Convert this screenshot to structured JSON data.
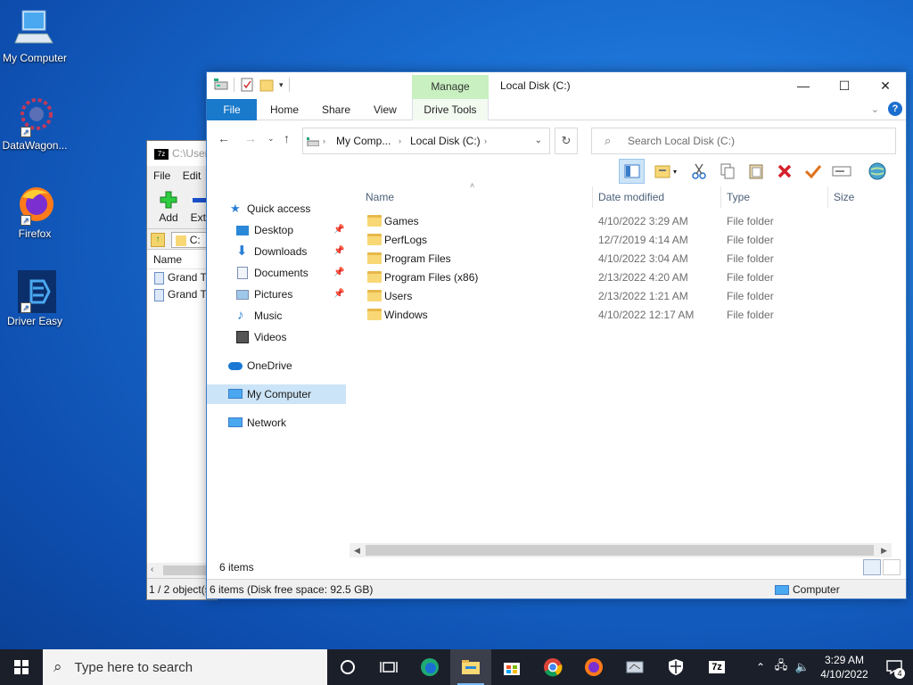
{
  "desktop": {
    "icons": [
      {
        "label": "My Computer"
      },
      {
        "label": "DataWagon..."
      },
      {
        "label": "Firefox"
      },
      {
        "label": "Driver Easy"
      }
    ]
  },
  "zip_window": {
    "title": "C:\\User",
    "logo": "7z",
    "menu": [
      "File",
      "Edit"
    ],
    "tools": [
      "Add",
      "Extr"
    ],
    "path_value": "C:",
    "column": "Name",
    "rows": [
      "Grand Th",
      "Grand Th"
    ],
    "status": "1 / 2 object(s"
  },
  "explorer": {
    "title": "Local Disk (C:)",
    "contextual_tab": "Manage",
    "ribbon_tabs": {
      "file": "File",
      "home": "Home",
      "share": "Share",
      "view": "View",
      "drive_tools": "Drive Tools"
    },
    "window_buttons": {
      "minimize": "—",
      "maximize": "☐",
      "close": "✕"
    },
    "address": {
      "crumb1": "My Comp...",
      "crumb2": "Local Disk (C:)"
    },
    "search_placeholder": "Search Local Disk (C:)",
    "nav": {
      "quick_access": "Quick access",
      "desktop": "Desktop",
      "downloads": "Downloads",
      "documents": "Documents",
      "pictures": "Pictures",
      "music": "Music",
      "videos": "Videos",
      "onedrive": "OneDrive",
      "my_computer": "My Computer",
      "network": "Network"
    },
    "columns": {
      "name": "Name",
      "date": "Date modified",
      "type": "Type",
      "size": "Size"
    },
    "files": [
      {
        "name": "Games",
        "date": "4/10/2022 3:29 AM",
        "type": "File folder"
      },
      {
        "name": "PerfLogs",
        "date": "12/7/2019 4:14 AM",
        "type": "File folder"
      },
      {
        "name": "Program Files",
        "date": "4/10/2022 3:04 AM",
        "type": "File folder"
      },
      {
        "name": "Program Files (x86)",
        "date": "2/13/2022 4:20 AM",
        "type": "File folder"
      },
      {
        "name": "Users",
        "date": "2/13/2022 1:21 AM",
        "type": "File folder"
      },
      {
        "name": "Windows",
        "date": "4/10/2022 12:17 AM",
        "type": "File folder"
      }
    ],
    "item_count": "6 items",
    "status_left": "6 items (Disk free space: 92.5 GB)",
    "status_right": "Computer"
  },
  "taskbar": {
    "search_placeholder": "Type here to search",
    "time": "3:29 AM",
    "date": "4/10/2022",
    "notification_count": "4",
    "zip_label": "7z"
  }
}
